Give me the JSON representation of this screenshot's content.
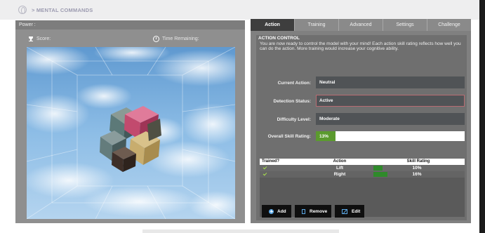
{
  "app": {
    "title": "> MENTAL COMMANDS"
  },
  "left_panel": {
    "power_label": "Power :",
    "score_label": "Score:",
    "time_label": "Time Remaining:"
  },
  "tabs": [
    {
      "label": "Action",
      "active": true
    },
    {
      "label": "Training",
      "active": false
    },
    {
      "label": "Advanced",
      "active": false
    },
    {
      "label": "Settings",
      "active": false
    },
    {
      "label": "Challenge",
      "active": false
    }
  ],
  "action_control": {
    "section_title": "ACTION CONTROL",
    "description": "You are now ready to control the model with your mind! Each action skill rating reflects how well you can do the action. More training would increase your cognitive ability.",
    "current_action_label": "Current Action:",
    "current_action_value": "Neutral",
    "detection_status_label": "Detection Status:",
    "detection_status_value": "Active",
    "difficulty_label": "Difficulty Level:",
    "difficulty_value": "Moderate",
    "overall_skill_label": "Overall Skill Rating:",
    "overall_skill_value": "13%",
    "overall_skill_fraction": 0.13
  },
  "actions_table": {
    "headers": {
      "trained": "Trained?",
      "action": "Action",
      "rating": "Skill Rating"
    },
    "rows": [
      {
        "trained": true,
        "action": "Lift",
        "rating": "10%",
        "rating_fraction": 0.1
      },
      {
        "trained": true,
        "action": "Right",
        "rating": "16%",
        "rating_fraction": 0.16
      }
    ]
  },
  "buttons": {
    "add": "Add",
    "remove": "Remove",
    "edit": "Edit"
  },
  "colors": {
    "accent_green": "#5b9a2e",
    "check_green": "#a8e24c",
    "icon_blue": "#5da9e6",
    "status_border": "#b86c73",
    "cube_pink": "#c24a6e",
    "cube_gold": "#c8ad6e",
    "cube_teal": "#5c7978",
    "sky_blue": "#6ba2d4"
  },
  "icons": {
    "logo": "brain-logo-icon",
    "score": "trophy-icon",
    "time": "clock-icon",
    "trained": "check-icon",
    "add": "plus-icon",
    "remove": "trash-icon",
    "edit": "edit-icon"
  }
}
